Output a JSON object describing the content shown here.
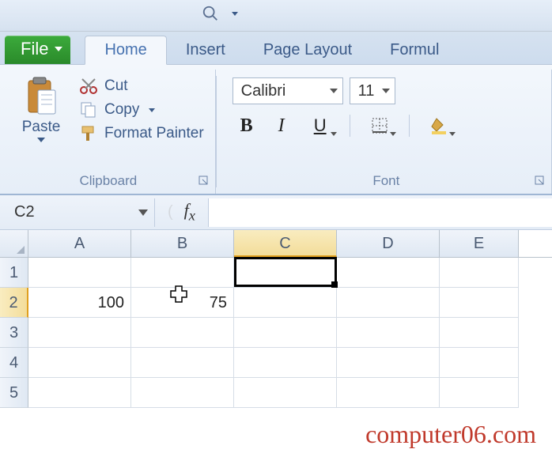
{
  "tabs": {
    "file": "File",
    "home": "Home",
    "insert": "Insert",
    "pageLayout": "Page Layout",
    "formulas": "Formul"
  },
  "clipboard": {
    "paste": "Paste",
    "cut": "Cut",
    "copy": "Copy",
    "formatPainter": "Format Painter",
    "title": "Clipboard"
  },
  "font": {
    "name": "Calibri",
    "size": "11",
    "title": "Font"
  },
  "nameBox": "C2",
  "columns": [
    "A",
    "B",
    "C",
    "D",
    "E"
  ],
  "rowNumbers": [
    "1",
    "2",
    "3",
    "4",
    "5"
  ],
  "activeColumnIndex": 2,
  "activeRowIndex": 1,
  "cells": {
    "A2": "100",
    "B2": "75"
  },
  "watermark": "computer06.com"
}
